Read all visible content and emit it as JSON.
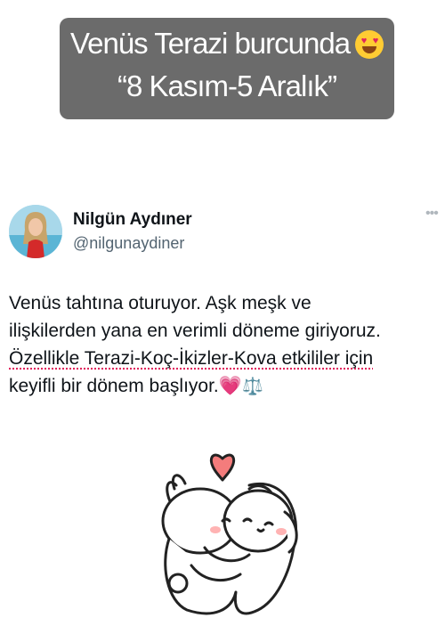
{
  "story": {
    "line1": "Venüs Terazi burcunda",
    "line2": "“8 Kasım-5 Aralık”",
    "emoji": "heart-eyes-icon"
  },
  "tweet": {
    "author_name": "Nilgün Aydıner",
    "author_handle": "@nilgunaydiner",
    "lines": [
      "Venüs tahtına oturuyor. Aşk meşk ve",
      "ilişkilerden yana en verimli döneme giriyoruz.",
      "Özellikle Terazi-Koç-İkizler-Kova etkililer için",
      "keyifli bir dönem başlıyor."
    ],
    "emojis": [
      "💗",
      "⚖️"
    ]
  },
  "colors": {
    "banner_bg": "#6b6b6b",
    "handle": "#536471",
    "heart": "#f14fa5"
  }
}
